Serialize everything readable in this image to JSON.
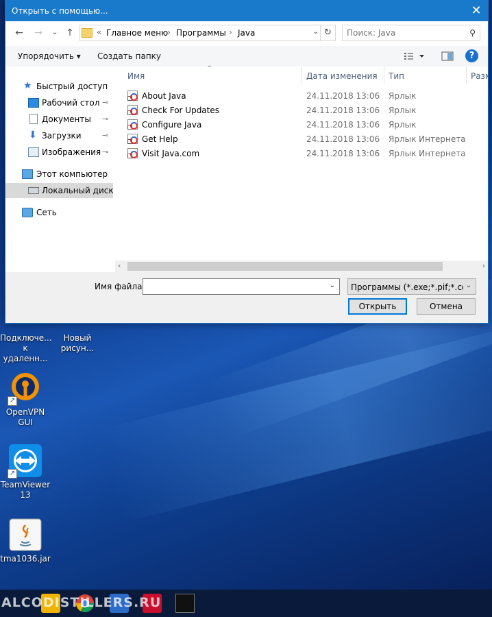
{
  "dialog": {
    "title": "Открыть с помощью...",
    "close_glyph": "✕"
  },
  "navigation": {
    "back_glyph": "←",
    "forward_glyph": "→",
    "recent_glyph": "⌄",
    "up_glyph": "↑",
    "breadcrumb_overflow": "«",
    "breadcrumbs": [
      "Главное меню",
      "Программы",
      "Java"
    ],
    "refresh_glyph": "↻"
  },
  "search": {
    "placeholder": "Поиск: Java"
  },
  "toolbar": {
    "organize_label": "Упорядочить ▾",
    "new_folder_label": "Создать папку",
    "help_glyph": "?"
  },
  "sidebar": {
    "items": [
      {
        "label": "Быстрый доступ",
        "icon": "star-icon"
      },
      {
        "label": "Рабочий стол",
        "icon": "desktop-icon",
        "pinned": true
      },
      {
        "label": "Документы",
        "icon": "documents-icon",
        "pinned": true
      },
      {
        "label": "Загрузки",
        "icon": "downloads-icon",
        "pinned": true
      },
      {
        "label": "Изображения",
        "icon": "pictures-icon",
        "pinned": true
      },
      {
        "label": "Этот компьютер",
        "icon": "computer-icon"
      },
      {
        "label": "Локальный диск (C",
        "icon": "drive-icon",
        "selected": true
      },
      {
        "label": "Сеть",
        "icon": "network-icon"
      }
    ],
    "pin_glyph": "📌"
  },
  "file_list": {
    "columns": [
      "Имя",
      "Дата изменения",
      "Тип",
      "Разм"
    ],
    "sort_glyph": "^",
    "rows": [
      {
        "name": "About Java",
        "date": "24.11.2018 13:06",
        "type": "Ярлык"
      },
      {
        "name": "Check For Updates",
        "date": "24.11.2018 13:06",
        "type": "Ярлык"
      },
      {
        "name": "Configure Java",
        "date": "24.11.2018 13:06",
        "type": "Ярлык"
      },
      {
        "name": "Get Help",
        "date": "24.11.2018 13:06",
        "type": "Ярлык Интернета"
      },
      {
        "name": "Visit Java.com",
        "date": "24.11.2018 13:06",
        "type": "Ярлык Интернета"
      }
    ]
  },
  "footer": {
    "filename_label": "Имя файла:",
    "filename_value": "",
    "filter_value": "Программы (*.exe;*.pif;*.com;",
    "open_label": "Открыть",
    "cancel_label": "Отмена"
  },
  "desktop": {
    "icons": [
      {
        "label": "Подключе... к удаленн...",
        "icon": "remote-desktop-icon"
      },
      {
        "label": "Новый рисун...",
        "icon": "paint-file-icon"
      },
      {
        "label": "OpenVPN GUI",
        "icon": "openvpn-icon"
      },
      {
        "label": "TeamViewer 13",
        "icon": "teamviewer-icon"
      },
      {
        "label": "tma1036.jar",
        "icon": "java-jar-icon"
      }
    ],
    "watermark": "ALCODISTILLERS.RU"
  },
  "colors": {
    "titlebar": "#1979ca",
    "primary_button_border": "#0078d7"
  }
}
